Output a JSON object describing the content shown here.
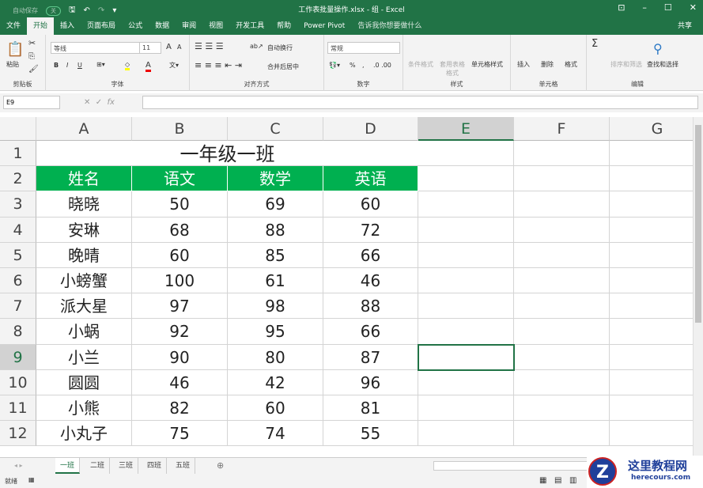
{
  "titlebar": {
    "autosave": "自动保存",
    "autosave_state": "关",
    "title": "工作表批量操作.xlsx - 组 - Excel"
  },
  "menu": [
    "文件",
    "开始",
    "插入",
    "页面布局",
    "公式",
    "数据",
    "审阅",
    "视图",
    "开发工具",
    "帮助",
    "Power Pivot"
  ],
  "tell_me": "告诉我你想要做什么",
  "share": "共享",
  "ribbon": {
    "clipboard": {
      "paste": "粘贴",
      "label": "剪贴板"
    },
    "font": {
      "name": "等线",
      "size": "11",
      "bold": "B",
      "italic": "I",
      "underline": "U",
      "label": "字体",
      "grow": "A",
      "shrink": "A",
      "color": "A"
    },
    "alignment": {
      "wrap": "自动换行",
      "merge": "合并后居中",
      "label": "对齐方式"
    },
    "number": {
      "format": "常规",
      "percent": "%",
      "comma": ",",
      "label": "数字"
    },
    "styles": {
      "conditional": "条件格式",
      "table": "套用表格格式",
      "cell": "单元格样式",
      "label": "样式"
    },
    "cells": {
      "insert": "插入",
      "delete": "删除",
      "format": "格式",
      "label": "单元格"
    },
    "editing": {
      "sum": "Σ",
      "sort": "排序和筛选",
      "find": "查找和选择",
      "label": "编辑"
    }
  },
  "formula": {
    "name_box": "E9",
    "value": ""
  },
  "columns": [
    "A",
    "B",
    "C",
    "D",
    "E",
    "F",
    "G"
  ],
  "selected_column": "E",
  "selected_row": "9",
  "rows": [
    "1",
    "2",
    "3",
    "4",
    "5",
    "6",
    "7",
    "8",
    "9",
    "10",
    "11",
    "12"
  ],
  "sheet": {
    "title": "一年级一班",
    "headers": [
      "姓名",
      "语文",
      "数学",
      "英语"
    ],
    "records": [
      [
        "晓晓",
        "50",
        "69",
        "60"
      ],
      [
        "安琳",
        "68",
        "88",
        "72"
      ],
      [
        "晚晴",
        "60",
        "85",
        "66"
      ],
      [
        "小螃蟹",
        "100",
        "61",
        "46"
      ],
      [
        "派大星",
        "97",
        "98",
        "88"
      ],
      [
        "小蜗",
        "92",
        "95",
        "66"
      ],
      [
        "小兰",
        "90",
        "80",
        "87"
      ],
      [
        "圆圆",
        "46",
        "42",
        "96"
      ],
      [
        "小熊",
        "82",
        "60",
        "81"
      ],
      [
        "小丸子",
        "75",
        "74",
        "55"
      ]
    ]
  },
  "tabs": [
    "一班",
    "二班",
    "三班",
    "四班",
    "五班"
  ],
  "active_tab": 0,
  "status": {
    "ready": "就绪"
  },
  "watermark": {
    "name": "这里教程网",
    "url": "herecours.com"
  },
  "colors": {
    "excel_green": "#217346",
    "header_fill": "#00b050"
  }
}
